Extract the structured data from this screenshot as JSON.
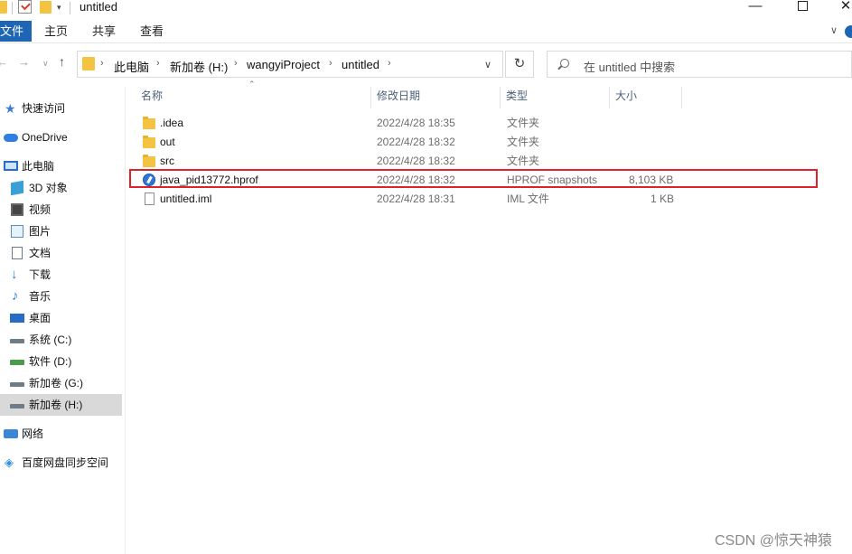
{
  "window": {
    "title": "untitled",
    "controls": {
      "minimize": "—",
      "maximize": "□",
      "close": "✕"
    }
  },
  "ribbon": {
    "file_tab": "文件",
    "tabs": [
      "主页",
      "共享",
      "查看"
    ]
  },
  "address": {
    "parts": [
      "此电脑",
      "新加卷 (H:)",
      "wangyiProject",
      "untitled"
    ],
    "refresh_symbol": "↻"
  },
  "search": {
    "placeholder": "在 untitled 中搜索"
  },
  "sidebar": {
    "items": [
      {
        "label": "快速访问",
        "icon": "star-icon"
      },
      {
        "label": "OneDrive",
        "icon": "cloud-icon"
      },
      {
        "label": "此电脑",
        "icon": "pc-icon"
      },
      {
        "label": "3D 对象",
        "icon": "cube-icon"
      },
      {
        "label": "视频",
        "icon": "video-icon"
      },
      {
        "label": "图片",
        "icon": "picture-icon"
      },
      {
        "label": "文档",
        "icon": "document-icon"
      },
      {
        "label": "下载",
        "icon": "download-icon"
      },
      {
        "label": "音乐",
        "icon": "music-icon"
      },
      {
        "label": "桌面",
        "icon": "desktop-icon"
      },
      {
        "label": "系统 (C:)",
        "icon": "drive-icon"
      },
      {
        "label": "软件 (D:)",
        "icon": "drive-icon"
      },
      {
        "label": "新加卷 (G:)",
        "icon": "drive-icon"
      },
      {
        "label": "新加卷 (H:)",
        "icon": "drive-icon",
        "selected": true
      },
      {
        "label": "网络",
        "icon": "network-icon"
      },
      {
        "label": "百度网盘同步空间",
        "icon": "baidu-icon"
      }
    ]
  },
  "columns": {
    "name": "名称",
    "date": "修改日期",
    "type": "类型",
    "size": "大小"
  },
  "files": [
    {
      "name": ".idea",
      "date": "2022/4/28 18:35",
      "type": "文件夹",
      "size": "",
      "icon": "folder-icon"
    },
    {
      "name": "out",
      "date": "2022/4/28 18:32",
      "type": "文件夹",
      "size": "",
      "icon": "folder-icon"
    },
    {
      "name": "src",
      "date": "2022/4/28 18:32",
      "type": "文件夹",
      "size": "",
      "icon": "folder-icon"
    },
    {
      "name": "java_pid13772.hprof",
      "date": "2022/4/28 18:32",
      "type": "HPROF snapshots",
      "size": "8,103 KB",
      "icon": "hprof-icon",
      "highlighted": true
    },
    {
      "name": "untitled.iml",
      "date": "2022/4/28 18:31",
      "type": "IML 文件",
      "size": "1 KB",
      "icon": "file-icon"
    }
  ],
  "watermark": "CSDN @惊天神猿",
  "colors": {
    "accent": "#1e66b4",
    "highlight_border": "#e0202a",
    "folder": "#f5c342",
    "selected_bg": "#d9d9d9"
  }
}
